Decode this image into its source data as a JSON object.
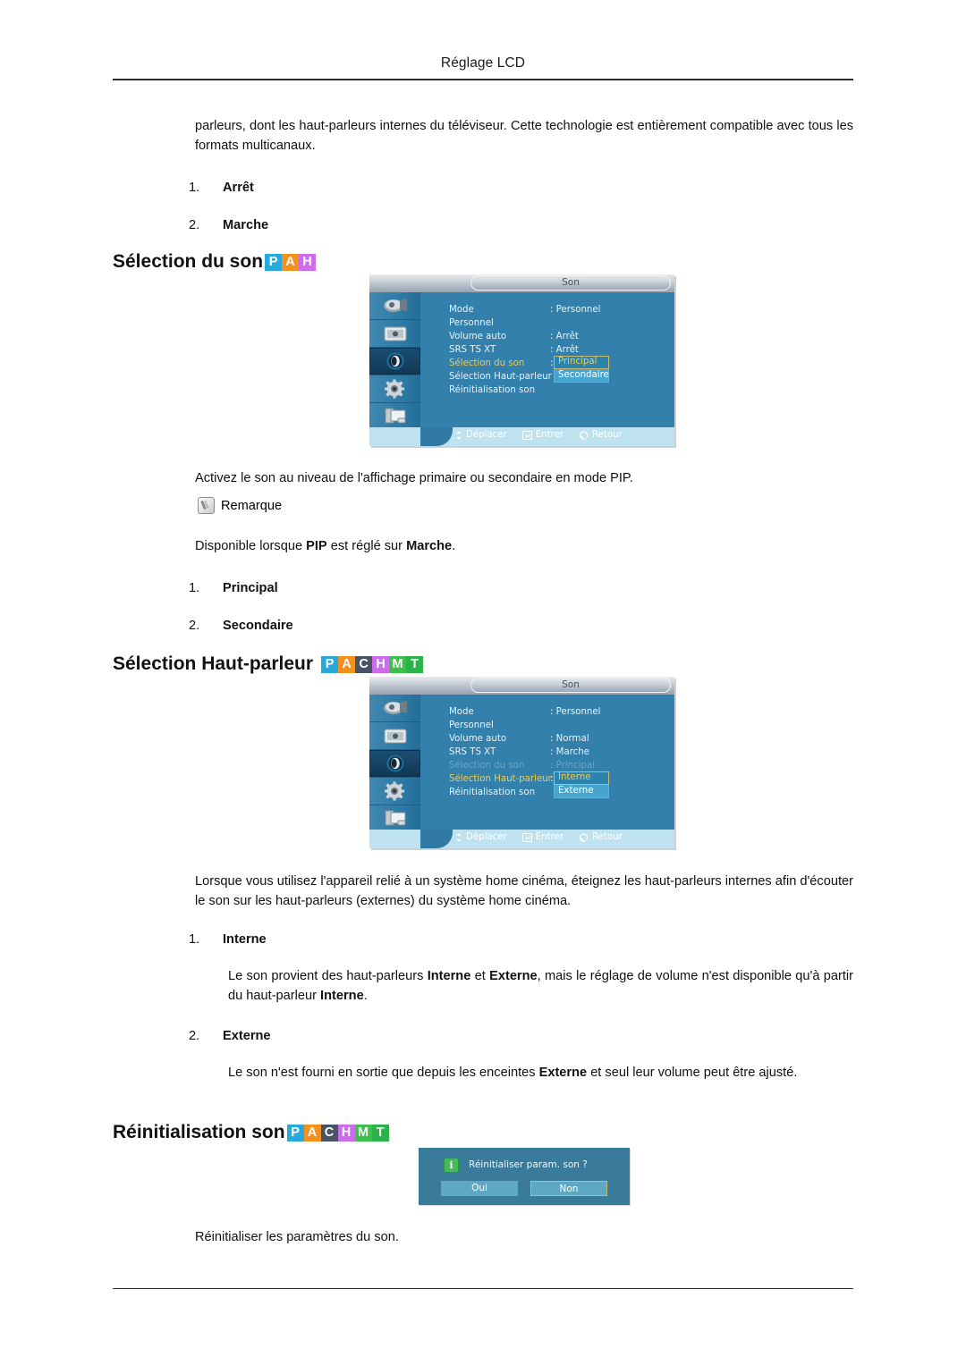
{
  "header": {
    "title": "Réglage LCD"
  },
  "intro": {
    "text": "parleurs, dont les haut-parleurs internes du téléviseur. Cette technologie est entièrement compatible avec tous les formats multicanaux."
  },
  "list_onoff": [
    {
      "num": "1.",
      "label": "Arrêt"
    },
    {
      "num": "2.",
      "label": "Marche"
    }
  ],
  "sections": [
    {
      "id": "selection-du-son",
      "heading": "Sélection du son",
      "badges": [
        {
          "letter": "P",
          "color": "#28a9dd"
        },
        {
          "letter": "A",
          "color": "#f4911e"
        },
        {
          "letter": "H",
          "color": "#cc6ceb"
        }
      ],
      "body": "Activez le son au niveau de l'affichage primaire ou secondaire en mode PIP.",
      "body_bold": "PIP",
      "note_label": "Remarque",
      "note_text_1": "Disponible lorsque ",
      "note_text_bold_1": "PIP",
      "note_text_2": " est réglé sur ",
      "note_text_bold_2": "Marche",
      "note_text_3": ".",
      "options": [
        {
          "num": "1.",
          "label": "Principal"
        },
        {
          "num": "2.",
          "label": "Secondaire"
        }
      ]
    },
    {
      "id": "selection-haut-parleur",
      "heading": "Sélection Haut-parleur",
      "badges": [
        {
          "letter": "P",
          "color": "#28a9dd"
        },
        {
          "letter": "A",
          "color": "#f4911e"
        },
        {
          "letter": "C",
          "color": "#4a5265"
        },
        {
          "letter": "H",
          "color": "#cc6ceb"
        },
        {
          "letter": "M",
          "color": "#3cc04a"
        },
        {
          "letter": "T",
          "color": "#2bb34b"
        }
      ],
      "body": "Lorsque vous utilisez l'appareil relié à un système home cinéma, éteignez les haut-parleurs internes afin d'écouter le son sur les haut-parleurs (externes) du système home cinéma.",
      "options": [
        {
          "num": "1.",
          "label": "Interne",
          "desc_1": "Le son provient des haut-parleurs ",
          "desc_b1": "Interne",
          "desc_2": " et ",
          "desc_b2": "Externe",
          "desc_3": ", mais le réglage de volume n'est disponible qu'à partir du haut-parleur ",
          "desc_b3": "Interne",
          "desc_4": "."
        },
        {
          "num": "2.",
          "label": "Externe",
          "desc_1": "Le son n'est fourni en sortie que depuis les enceintes ",
          "desc_b1": "Externe",
          "desc_2": " et seul leur volume peut être ajusté.",
          "desc_b2": "",
          "desc_3": "",
          "desc_b3": "",
          "desc_4": ""
        }
      ]
    },
    {
      "id": "reinitialisation-son",
      "heading": "Réinitialisation son",
      "badges": [
        {
          "letter": "P",
          "color": "#28a9dd"
        },
        {
          "letter": "A",
          "color": "#f4911e"
        },
        {
          "letter": "C",
          "color": "#4a5265"
        },
        {
          "letter": "H",
          "color": "#cc6ceb"
        },
        {
          "letter": "M",
          "color": "#3cc04a"
        },
        {
          "letter": "T",
          "color": "#2bb34b"
        }
      ],
      "body": "Réinitialiser les paramètres du son."
    }
  ],
  "osd_common": {
    "title": "Son",
    "sidebar_icons": [
      "input-source-icon",
      "picture-icon",
      "sound-icon",
      "setup-gear-icon",
      "multi-control-icon"
    ],
    "keys": [
      {
        "icon": "move-icon",
        "label": "Déplacer"
      },
      {
        "icon": "enter-icon",
        "label": "Entrer"
      },
      {
        "icon": "return-icon",
        "label": "Retour"
      }
    ]
  },
  "osd_sound_select": {
    "rows": [
      {
        "label": "Mode",
        "value": ": Personnel",
        "state": "normal"
      },
      {
        "label": "Personnel",
        "value": "",
        "state": "normal"
      },
      {
        "label": "Volume auto",
        "value": ": Arrêt",
        "state": "normal"
      },
      {
        "label": "SRS TS XT",
        "value": ": Arrêt",
        "state": "normal"
      },
      {
        "label": "Sélection du son",
        "value": ":",
        "state": "highlight"
      },
      {
        "label": "Sélection Haut-parleur",
        "value": "",
        "state": "normal"
      },
      {
        "label": "Réinitialisation son",
        "value": "",
        "state": "normal"
      }
    ],
    "popup": {
      "current": "Principal",
      "other": "Secondaire"
    }
  },
  "osd_speaker_select": {
    "rows": [
      {
        "label": "Mode",
        "value": ": Personnel",
        "state": "normal"
      },
      {
        "label": "Personnel",
        "value": "",
        "state": "normal"
      },
      {
        "label": "Volume auto",
        "value": ": Normal",
        "state": "normal"
      },
      {
        "label": "SRS TS XT",
        "value": ": Marche",
        "state": "normal"
      },
      {
        "label": "Sélection du son",
        "value": ": Principal",
        "state": "dim"
      },
      {
        "label": "Sélection Haut-parleur",
        "value": ":",
        "state": "highlight"
      },
      {
        "label": "Réinitialisation son",
        "value": "",
        "state": "normal"
      }
    ],
    "popup": {
      "current": "Interne",
      "other": "Externe"
    }
  },
  "reset_dialog": {
    "icon": "info-icon",
    "message": "Réinitialiser param. son ?",
    "yes": "Oui",
    "no": "Non"
  }
}
